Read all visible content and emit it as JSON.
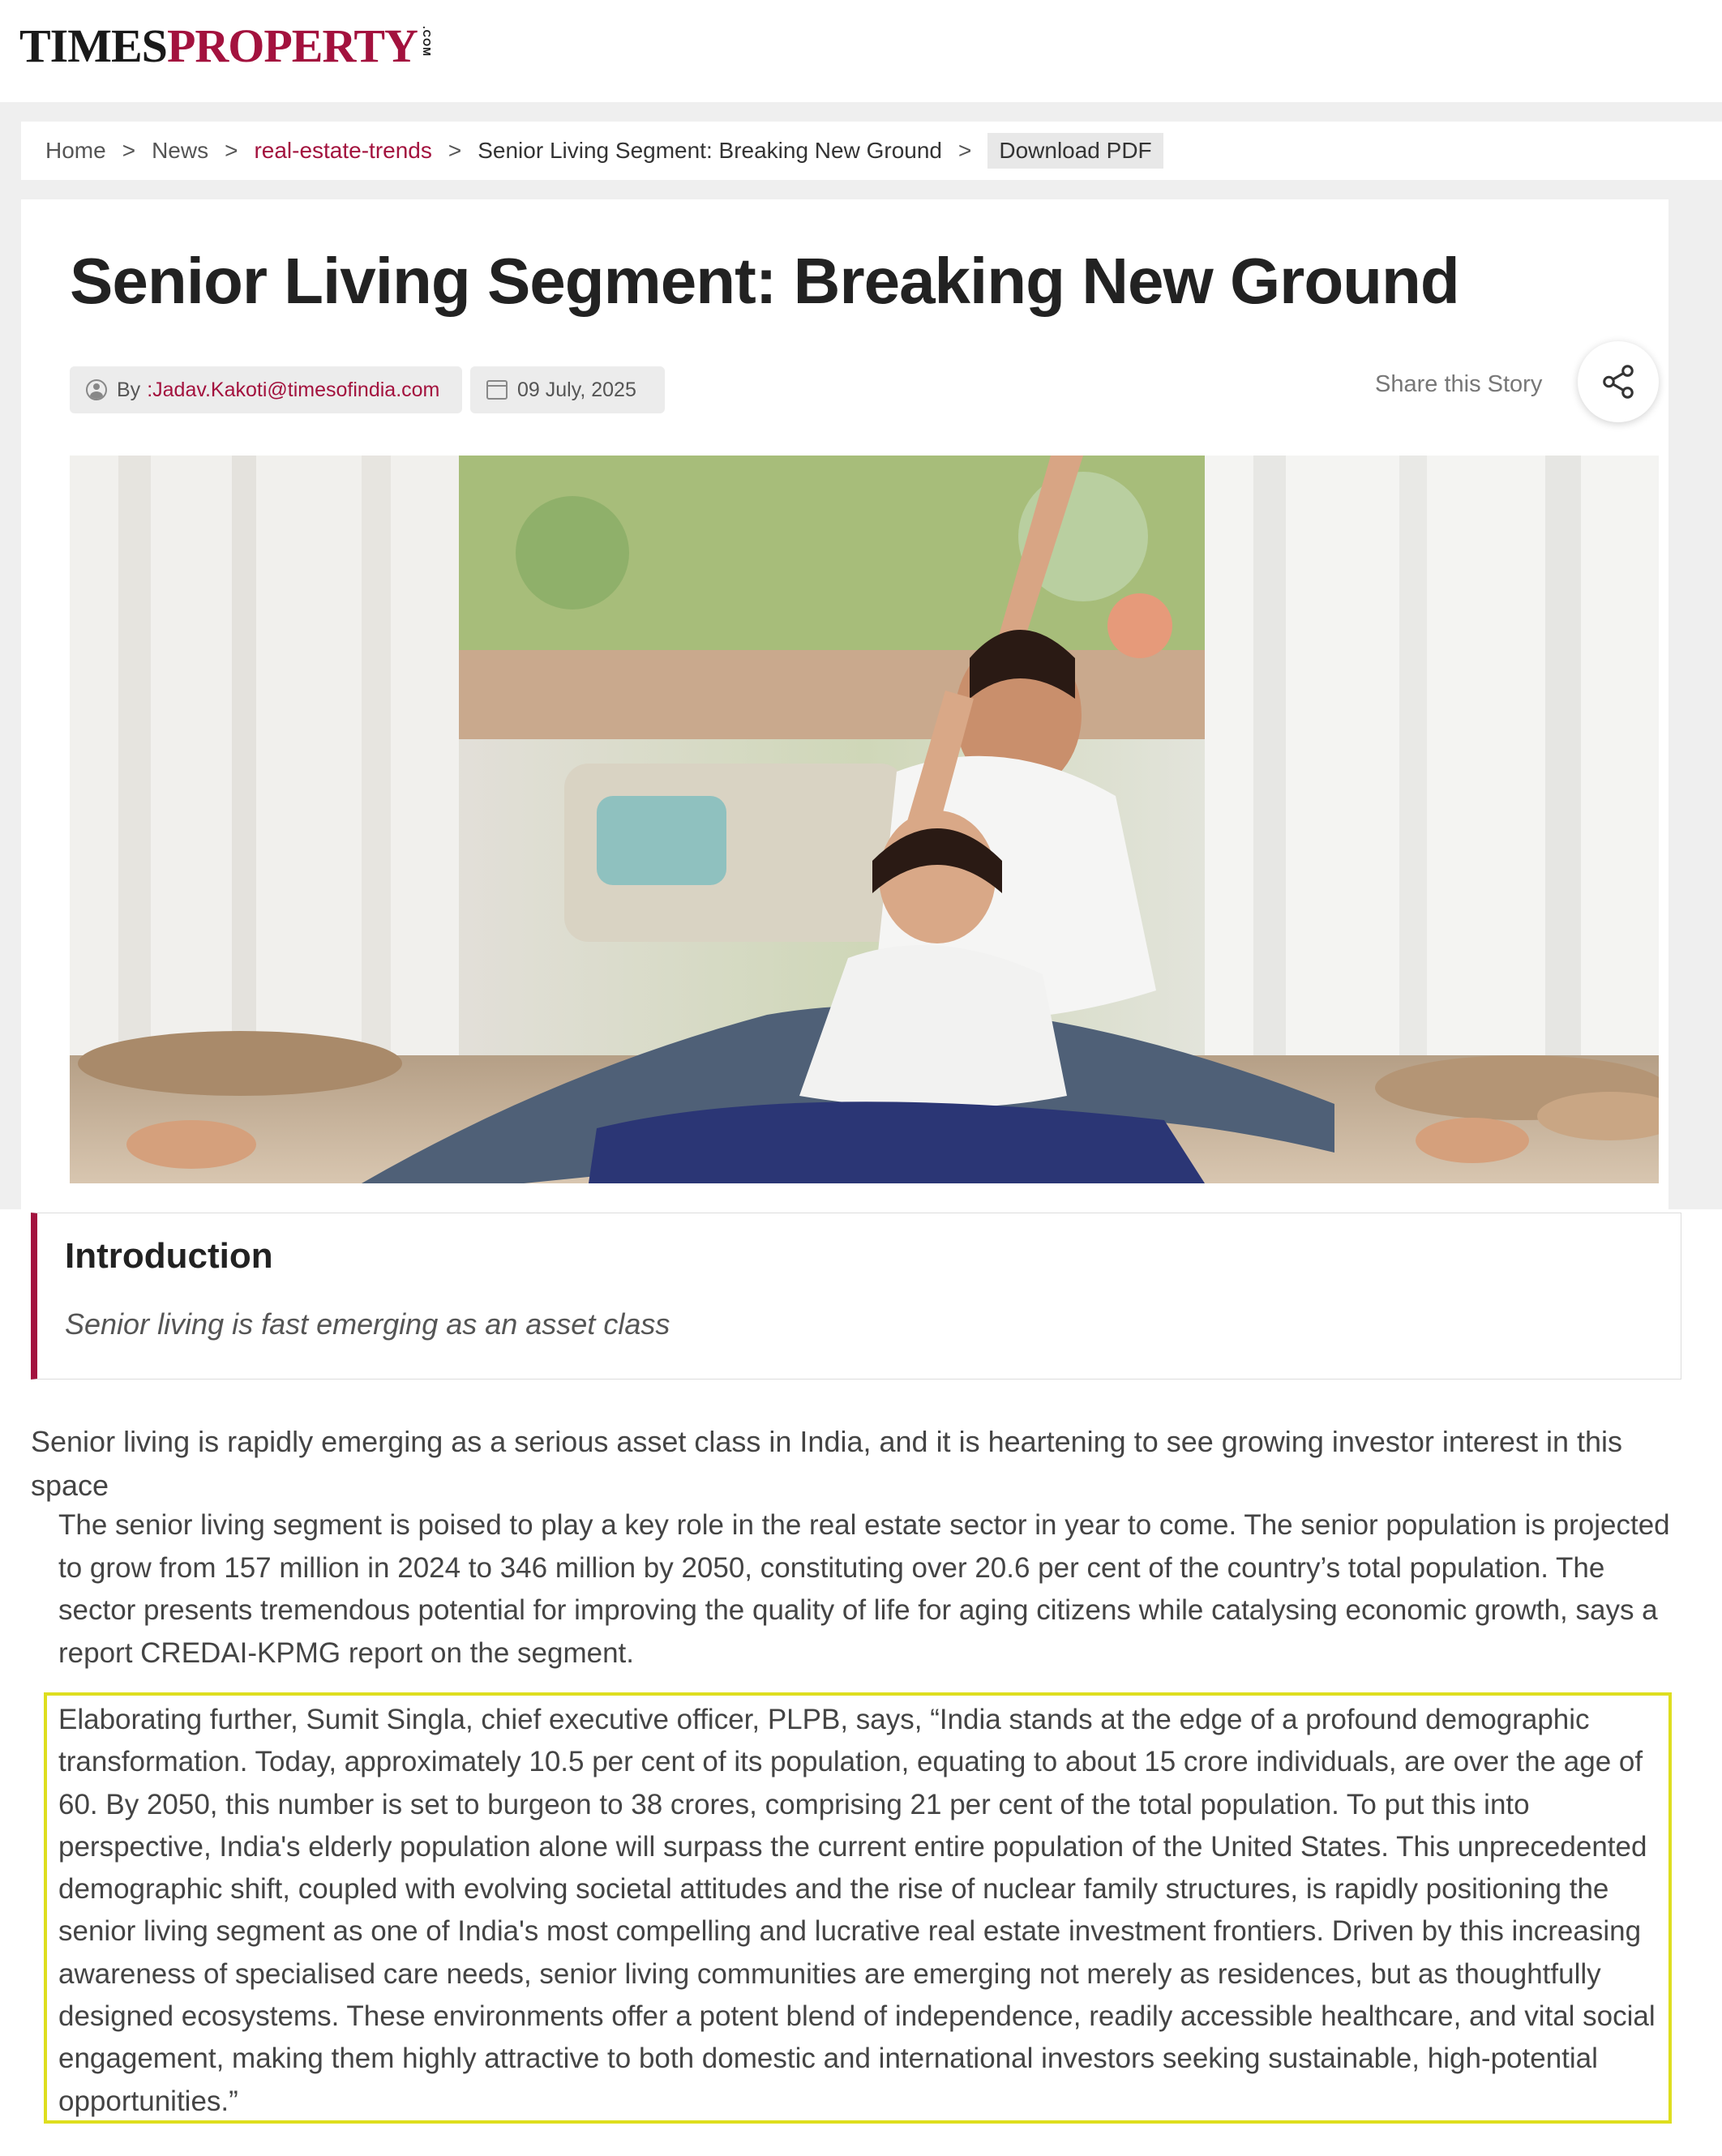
{
  "brand": {
    "times": "TIMES",
    "property": "PROPERTY",
    "com": ".COM"
  },
  "breadcrumb": {
    "home": "Home",
    "news": "News",
    "category": "real-estate-trends",
    "current": "Senior Living Segment: Breaking New Ground",
    "download": "Download PDF",
    "separator": ">"
  },
  "article": {
    "title": "Senior Living Segment: Breaking New Ground",
    "by_label": "By",
    "author": ":Jadav.Kakoti@timesofindia.com",
    "date": "09 July, 2025",
    "share_label": "Share this Story"
  },
  "intro": {
    "heading": "Introduction",
    "subheading": "Senior living is fast emerging as an asset class"
  },
  "body": {
    "lead": "Senior living is rapidly emerging as a serious asset class in India, and it is heartening to see growing investor interest in this space",
    "paragraph1": "The senior living segment is poised to play a key role in the real estate sector in year to come. The senior population is projected to grow from 157 million in 2024 to 346 million by 2050, constituting over 20.6 per cent of the country’s total population. The sector presents tremendous potential for improving the quality of life for aging citizens while catalysing economic growth, says a report CREDAI-KPMG report on the segment.",
    "paragraph2": "Elaborating further, Sumit Singla, chief executive officer, PLPB, says, “India stands at the edge of a profound demographic transformation. Today, approximately 10.5 per cent of its population, equating to about 15 crore individuals, are over the age of 60. By 2050, this number is set to burgeon to 38 crores, comprising 21 per cent of the total population. To put this into perspective, India's elderly population alone will surpass the current entire population of the United States. This unprecedented demographic shift, coupled with evolving societal attitudes and the rise of nuclear family structures, is rapidly positioning the senior living segment as one of India's most compelling and lucrative real estate investment frontiers. Driven by this increasing awareness of specialised care needs, senior living communities are emerging not merely as residences, but as thoughtfully designed ecosystems. These environments offer a potent blend of independence, readily accessible healthcare, and vital social engagement, making them highly attractive to both domestic and international investors seeking sustainable, high-potential opportunities.”"
  },
  "colors": {
    "brand": "#a3123e",
    "highlight": "#dede1e"
  }
}
